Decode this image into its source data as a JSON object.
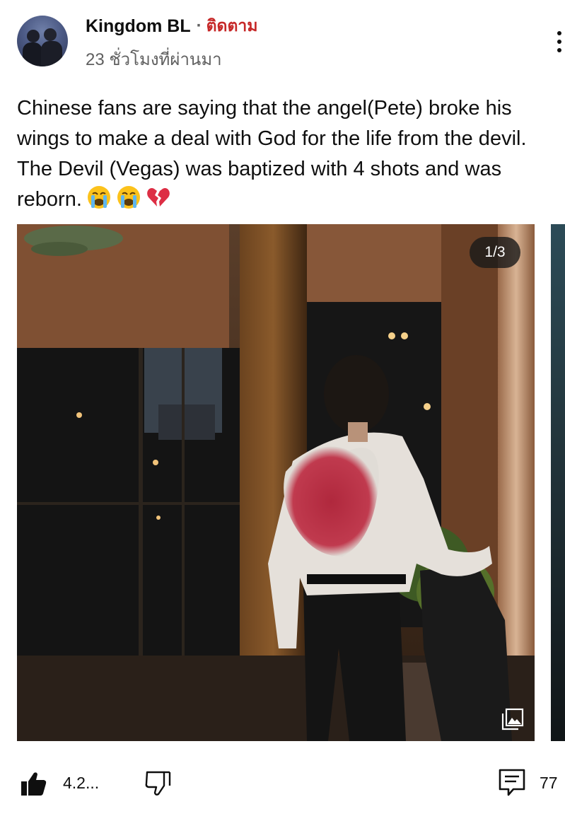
{
  "post": {
    "channel_name": "Kingdom BL",
    "separator": "·",
    "follow_label": "ติดตาม",
    "time_ago": "23 ชั่วโมงที่ผ่านมา",
    "text": "Chinese fans are saying that the angel(Pete) broke his wings to make a deal with God for the life from the devil. The Devil (Vegas) was baptized with 4 shots and was reborn.",
    "emojis": [
      "loudly-crying-face",
      "loudly-crying-face",
      "broken-heart"
    ]
  },
  "image": {
    "counter": "1/3",
    "gallery_icon": "image-gallery-icon"
  },
  "actions": {
    "like_count": "4.2...",
    "comment_count": "77",
    "icons": [
      "thumbs-up-icon",
      "thumbs-down-icon",
      "comment-icon"
    ]
  },
  "colors": {
    "follow": "#c62828",
    "secondary_text": "#606060",
    "text": "#0f0f0f",
    "background": "#ffffff"
  }
}
